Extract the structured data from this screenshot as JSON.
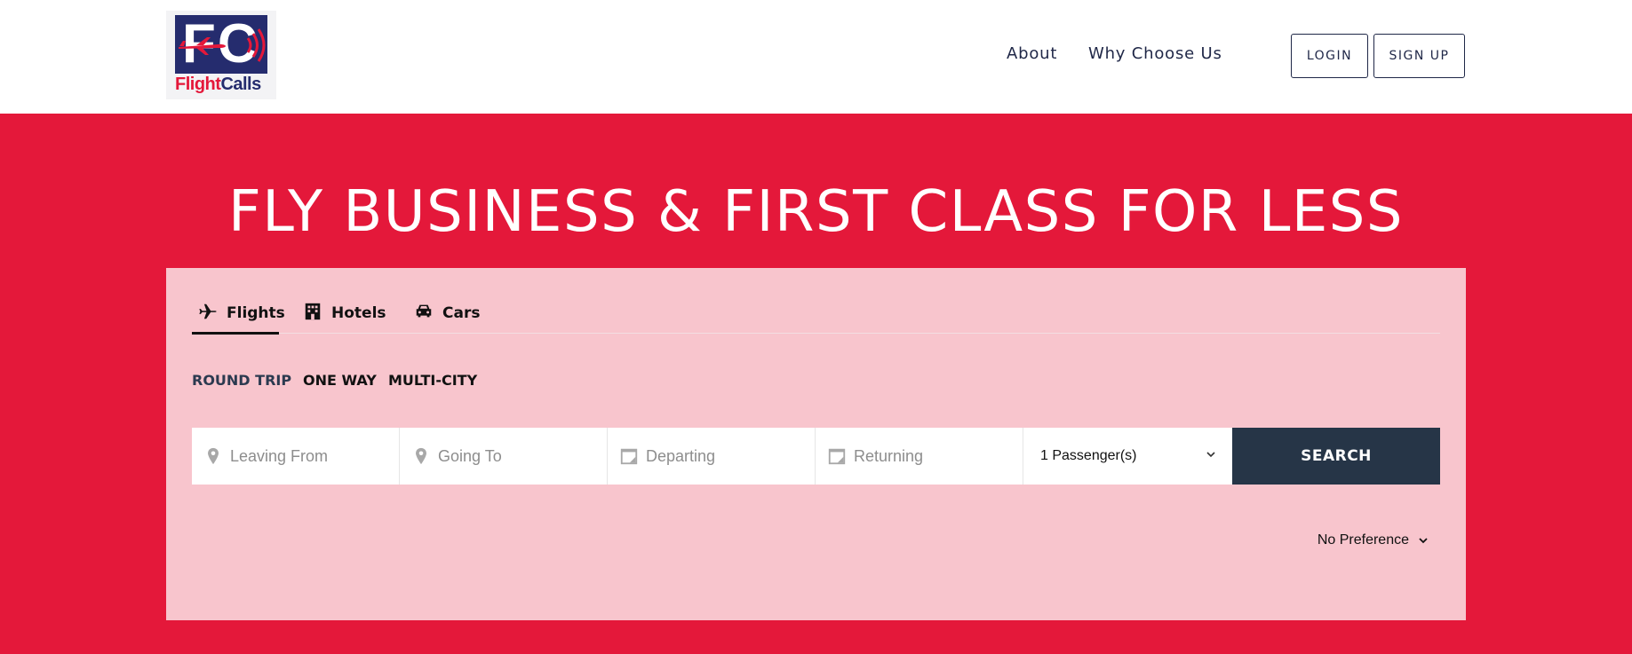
{
  "brand": {
    "logo_letters": "FC",
    "logo_text_part1": "Flight",
    "logo_text_part2": "Calls",
    "colors": {
      "navy": "#252c6e",
      "red": "#e4183a"
    }
  },
  "nav": {
    "links": [
      {
        "label": "About"
      },
      {
        "label": "Why Choose Us"
      }
    ],
    "login_label": "LOGIN",
    "signup_label": "SIGN UP"
  },
  "hero": {
    "title": "FLY BUSINESS & FIRST CLASS FOR LESS",
    "background_color": "#e4183a",
    "panel_color": "#f8c5cd"
  },
  "search": {
    "tabs": [
      {
        "label": "Flights",
        "icon": "plane-icon",
        "active": true
      },
      {
        "label": "Hotels",
        "icon": "building-icon",
        "active": false
      },
      {
        "label": "Cars",
        "icon": "car-icon",
        "active": false
      }
    ],
    "trip_types": [
      {
        "label": "ROUND TRIP",
        "active": true
      },
      {
        "label": "ONE WAY",
        "active": false
      },
      {
        "label": "MULTI-CITY",
        "active": false
      }
    ],
    "fields": {
      "leaving_from": {
        "placeholder": "Leaving From",
        "icon": "map-pin-icon"
      },
      "going_to": {
        "placeholder": "Going To",
        "icon": "map-pin-icon"
      },
      "departing": {
        "placeholder": "Departing",
        "icon": "calendar-icon"
      },
      "returning": {
        "placeholder": "Returning",
        "icon": "calendar-icon"
      }
    },
    "passengers": {
      "value": "1 Passenger(s)"
    },
    "search_button_label": "SEARCH",
    "search_button_color": "#263547",
    "preference": {
      "value": "No Preference"
    }
  }
}
